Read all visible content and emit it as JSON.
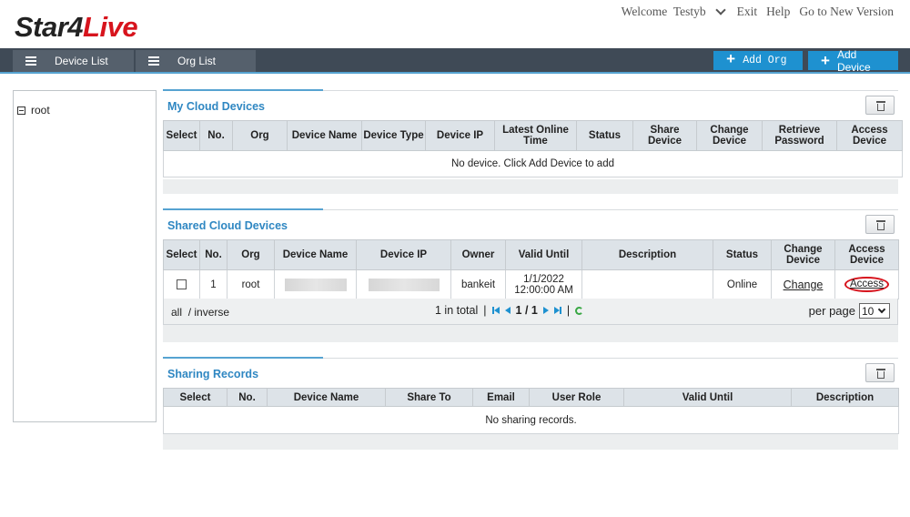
{
  "header": {
    "logo_part1": "Star4",
    "logo_part2": "Live",
    "welcome": "Welcome",
    "user": "Testyb",
    "exit": "Exit",
    "help": "Help",
    "new_version": "Go to New Version"
  },
  "nav": {
    "tabs": [
      {
        "label": "Device List",
        "icon": "list-icon"
      },
      {
        "label": "Org List",
        "icon": "list-icon"
      }
    ],
    "add_org": "Add Org",
    "add_device": "Add Device"
  },
  "tree": {
    "root_label": "root"
  },
  "my_cloud": {
    "title": "My Cloud Devices",
    "columns": [
      "Select",
      "No.",
      "Org",
      "Device Name",
      "Device Type",
      "Device IP",
      "Latest Online Time",
      "Status",
      "Share Device",
      "Change Device",
      "Retrieve Password",
      "Access Device"
    ],
    "empty_text": "No device. Click Add Device to add"
  },
  "shared_cloud": {
    "title": "Shared Cloud Devices",
    "columns": [
      "Select",
      "No.",
      "Org",
      "Device Name",
      "Device IP",
      "Owner",
      "Valid Until",
      "Description",
      "Status",
      "Change Device",
      "Access Device"
    ],
    "rows": [
      {
        "no": "1",
        "org": "root",
        "owner": "bankeit",
        "valid_until_date": "1/1/2022",
        "valid_until_time": "12:00:00 AM",
        "description": "",
        "status": "Online",
        "change": "Change",
        "access": "Access"
      }
    ],
    "pager": {
      "all": "all",
      "inverse": "/ inverse",
      "total": "1 in total",
      "page": "1 / 1",
      "per_page_label": "per page",
      "per_page_value": "10"
    }
  },
  "sharing_records": {
    "title": "Sharing Records",
    "columns": [
      "Select",
      "No.",
      "Device Name",
      "Share To",
      "Email",
      "User Role",
      "Valid Until",
      "Description"
    ],
    "empty_text": "No sharing records."
  },
  "colors": {
    "accent": "#1e91d0",
    "brand_red": "#d7141d",
    "navbar": "#3f4a56",
    "title_blue": "#2f87c2"
  }
}
